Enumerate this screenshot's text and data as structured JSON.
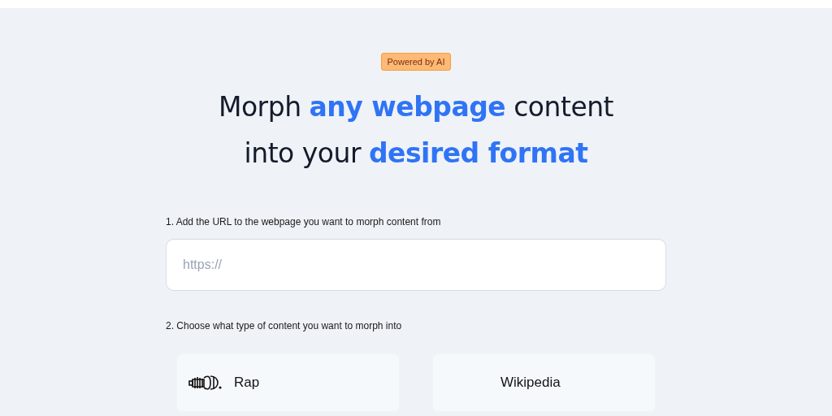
{
  "badge": "Powered by AI",
  "headline": [
    "Morph **any webpage** content",
    "into your **desired format**"
  ],
  "steps": [
    {
      "label": "1. Add the URL to the webpage you want to morph content from",
      "placeholder": "https://"
    },
    {
      "label": "2. Choose what type of content you want to morph into"
    }
  ],
  "options": [
    {
      "label": "Rap",
      "icon": true
    },
    {
      "label": "Wikipedia",
      "icon": false
    }
  ]
}
